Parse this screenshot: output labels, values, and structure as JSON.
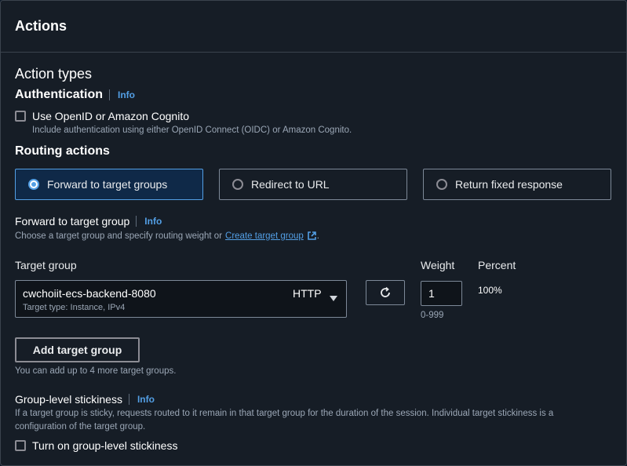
{
  "panel": {
    "title": "Actions"
  },
  "action_types": {
    "heading": "Action types"
  },
  "authentication": {
    "heading": "Authentication",
    "info": "Info",
    "checkbox_label": "Use OpenID or Amazon Cognito",
    "checkbox_desc": "Include authentication using either OpenID Connect (OIDC) or Amazon Cognito.",
    "checked": false
  },
  "routing": {
    "heading": "Routing actions",
    "options": [
      {
        "label": "Forward to target groups",
        "selected": true
      },
      {
        "label": "Redirect to URL",
        "selected": false
      },
      {
        "label": "Return fixed response",
        "selected": false
      }
    ]
  },
  "forward": {
    "heading": "Forward to target group",
    "info": "Info",
    "desc_prefix": "Choose a target group and specify routing weight or",
    "create_link": "Create target group",
    "desc_suffix": "."
  },
  "target_group": {
    "label": "Target group",
    "selected_name": "cwchoiit-ecs-backend-8080",
    "selected_detail": "Target type: Instance, IPv4",
    "protocol": "HTTP",
    "weight_label": "Weight",
    "weight_value": "1",
    "weight_hint": "0-999",
    "percent_label": "Percent",
    "percent_value": "100%"
  },
  "add_target": {
    "button_label": "Add target group",
    "hint": "You can add up to 4 more target groups."
  },
  "stickiness": {
    "heading": "Group-level stickiness",
    "info": "Info",
    "desc_line1": "If a target group is sticky, requests routed to it remain in that target group for the duration of the session. Individual target stickiness is a",
    "desc_line2": "configuration of the target group.",
    "checkbox_label": "Turn on group-level stickiness",
    "checked": false
  },
  "icons": {
    "external_link": "external-link-icon",
    "refresh": "refresh-icon",
    "caret": "caret-down-icon"
  },
  "colors": {
    "background": "#161d26",
    "accent": "#539fe5",
    "selected_tile_bg": "#0f2948",
    "border": "#7d8998"
  }
}
